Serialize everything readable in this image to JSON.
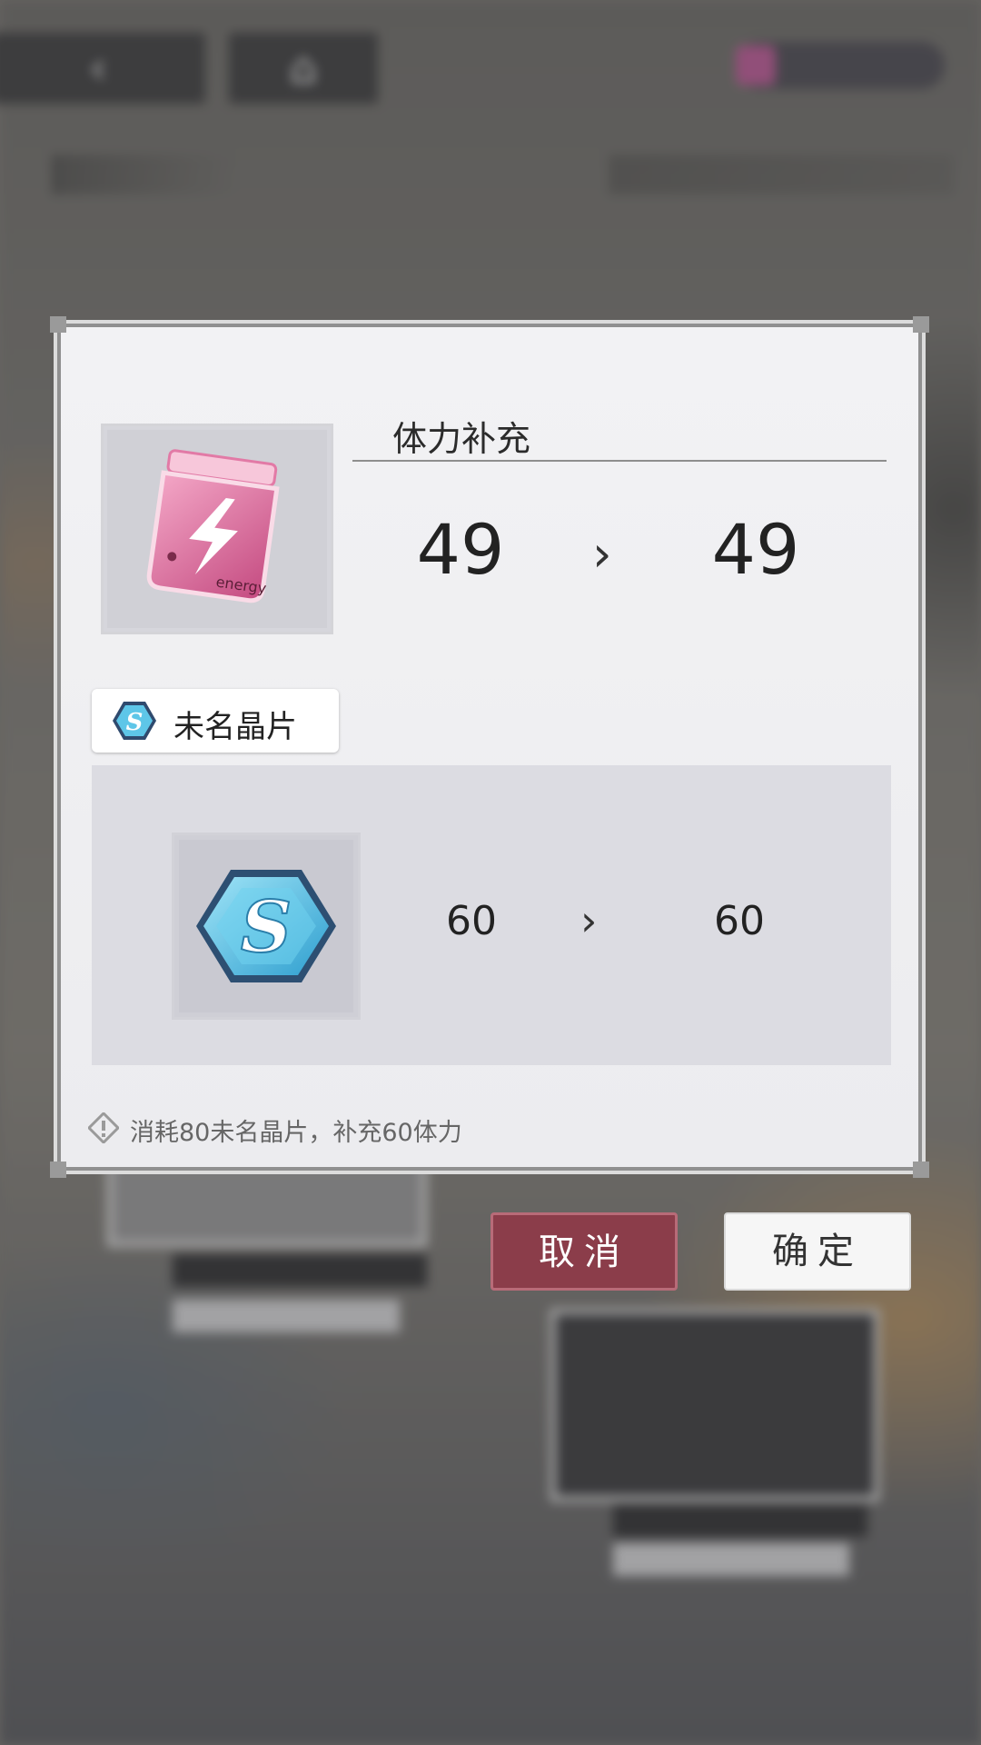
{
  "background": {
    "nav_back_glyph": "‹",
    "nav_home_glyph": "⌂"
  },
  "dialog": {
    "energy": {
      "title": "体力补充",
      "current": "49",
      "after": "49",
      "icon": "energy-jar-icon",
      "icon_text": "energy",
      "arrow": "›"
    },
    "crystal": {
      "label": "未名晶片",
      "current": "60",
      "after": "60",
      "icon": "crystal-s-icon",
      "icon_letter": "S",
      "arrow": "›"
    },
    "hint": "消耗80未名晶片，补充60体力"
  },
  "buttons": {
    "cancel": "取消",
    "confirm": "确定"
  },
  "colors": {
    "cancel_bg": "#8b3d4a",
    "confirm_bg": "#f6f6f6",
    "energy_pink": "#d9659a",
    "crystal_blue": "#4fc0e3"
  }
}
